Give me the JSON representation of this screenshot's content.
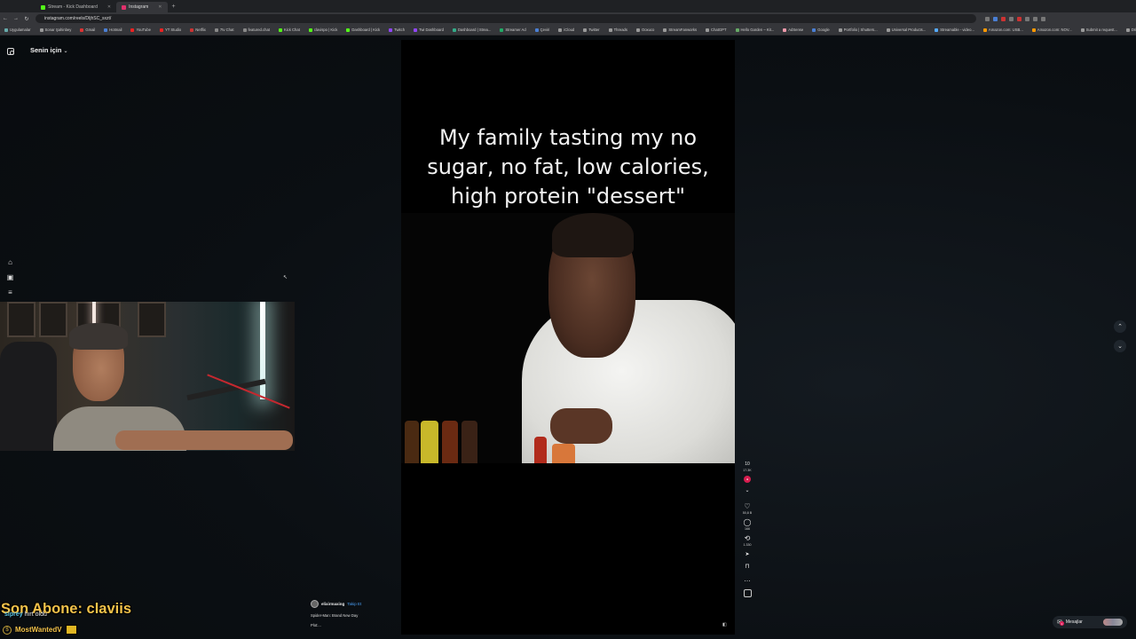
{
  "browser": {
    "tabs": [
      {
        "label": "Stream - Kick Dashboard",
        "active": false,
        "favicon_color": "#53fc18"
      },
      {
        "label": "Instagram",
        "active": true,
        "favicon_color": "#e1306c"
      }
    ],
    "new_tab": "+",
    "url": "instagram.com/reels/DIjhSC_sxzt/",
    "nav": {
      "back": "←",
      "forward": "→",
      "reload": "↻"
    },
    "bookmarks": [
      "Uygulamalar",
      "Sonar Şahinbey",
      "Gmail",
      "Hotmail",
      "YouTube",
      "YT Studio",
      "Netflix",
      "7tv Chat",
      "featured.chat",
      "Kick Chat",
      "clavispo | Kick",
      "Dashboard | Kick",
      "Twitch",
      "Twi Dashboard",
      "Dashboard | Strea...",
      "Streamer Ad",
      "Çeviri",
      "iCloud",
      "Twitter",
      "Threads",
      "Ooxuco",
      "StreamFanworks",
      "ChatGPT",
      "Hello Garden – Kit...",
      "AdSense",
      "Google",
      "Portfolio | Shutters...",
      "Universal Products...",
      "Streamable - video...",
      "Amazon.com: USB...",
      "Amazon.com: NOV...",
      "Submit a request...",
      "Drive & Listen",
      "Tüm Yer İşaretleri"
    ]
  },
  "instagram": {
    "feed_title": "Senin için",
    "chevron": "⌄",
    "caption_lines": [
      "My family tasting my no",
      "sugar, no fat, low calories,",
      "high protein \"dessert\""
    ],
    "rail": {
      "live": "10",
      "live_sub": "17.3K",
      "like_icon": "♡",
      "like_count": "50,8 B",
      "comment_icon": "◯",
      "comment_count": "166",
      "repost_icon": "⟲",
      "repost_count": "1.330",
      "share_icon": "➤",
      "save_icon": "🔖",
      "more_icon": "…"
    },
    "author": {
      "name": "elixirmaxing",
      "follow": "Takip Et",
      "song": "Spider-Man: Brand New Day",
      "description": "Plot:..."
    },
    "messages_label": "Mesajlar",
    "messages_badge": "1"
  },
  "overlay": {
    "last_sub": "Son Abone: claviis",
    "follower_name": "siprey",
    "follower_suffix": " hırt oldu",
    "last_bits": "MostWantedV"
  },
  "colors": {
    "accent_pink": "#d71d4f",
    "overlay_gold": "#f3c24a",
    "link_blue": "#4a9ff5"
  }
}
